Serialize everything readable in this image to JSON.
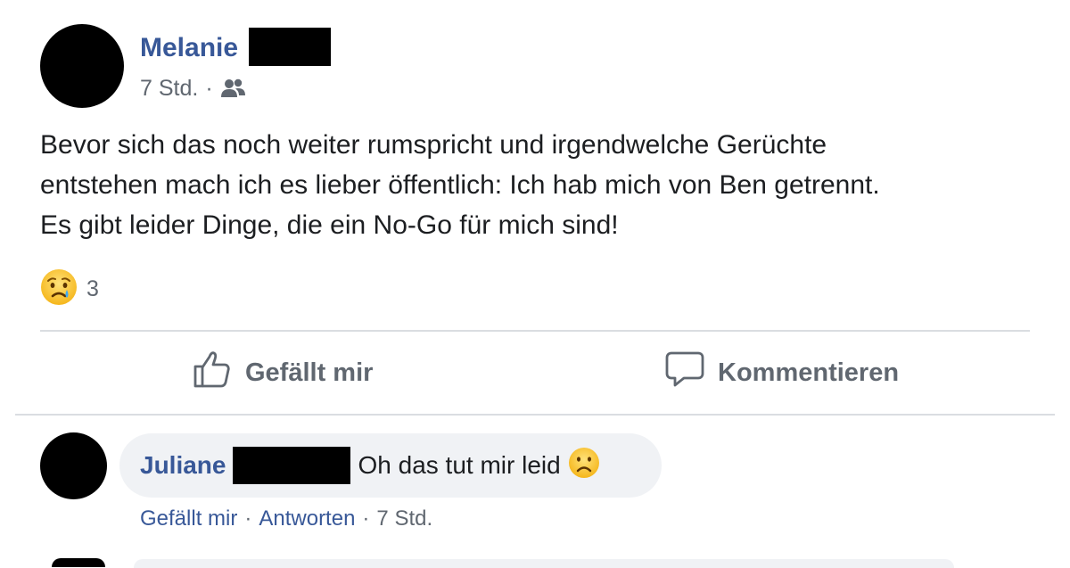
{
  "post": {
    "author": "Melanie",
    "time": "7 Std.",
    "meta_separator": "·",
    "audience_icon": "friends-icon",
    "text_lines": [
      "Bevor sich das noch weiter rumspricht und irgendwelche Gerüchte",
      "entstehen mach ich es lieber öffentlich: Ich hab mich von Ben getrennt.",
      "Es gibt leider Dinge, die ein No-Go für mich sind!"
    ],
    "reaction_icon": "sad-crying-emoji-icon",
    "reaction_count": "3"
  },
  "actions": {
    "like_label": "Gefällt mir",
    "comment_label": "Kommentieren"
  },
  "comment": {
    "author": "Juliane",
    "text": "Oh das tut mir leid",
    "emoji_icon": "sad-frowning-emoji-icon",
    "like_label": "Gefällt mir",
    "reply_label": "Antworten",
    "time": "7 Std.",
    "separator": "·"
  },
  "colors": {
    "author_link": "#385898",
    "secondary_text": "#606770",
    "bubble_bg": "#f0f2f5",
    "divider": "#dadde1"
  }
}
